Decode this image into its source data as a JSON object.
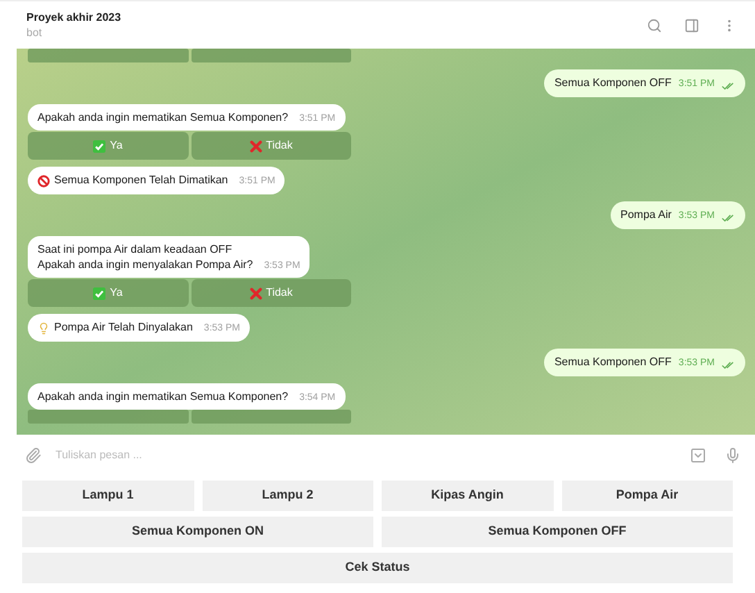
{
  "header": {
    "title": "Proyek akhir 2023",
    "subtitle": "bot"
  },
  "messages": [
    {
      "kind": "buttons-cut",
      "buttons": [
        {
          "kind": "yes"
        },
        {
          "kind": "no"
        }
      ]
    },
    {
      "kind": "outgoing",
      "text": "Semua Komponen OFF",
      "time": "3:51 PM",
      "read": true
    },
    {
      "kind": "incoming",
      "lines": [
        "Apakah anda ingin mematikan Semua Komponen?"
      ],
      "time": "3:51 PM"
    },
    {
      "kind": "buttons",
      "buttons": [
        {
          "kind": "yes",
          "label": "Ya"
        },
        {
          "kind": "no",
          "label": "Tidak"
        }
      ]
    },
    {
      "kind": "notice",
      "on": false,
      "text": "Semua Komponen Telah Dimatikan",
      "time": "3:51 PM"
    },
    {
      "kind": "outgoing",
      "text": "Pompa Air",
      "time": "3:53 PM",
      "read": true
    },
    {
      "kind": "incoming",
      "lines": [
        "Saat ini pompa Air dalam keadaan OFF",
        "Apakah anda ingin menyalakan Pompa Air?"
      ],
      "time": "3:53 PM"
    },
    {
      "kind": "buttons",
      "buttons": [
        {
          "kind": "yes",
          "label": "Ya"
        },
        {
          "kind": "no",
          "label": "Tidak"
        }
      ]
    },
    {
      "kind": "notice",
      "on": true,
      "text": "Pompa Air Telah Dinyalakan",
      "time": "3:53 PM"
    },
    {
      "kind": "outgoing",
      "text": "Semua Komponen OFF",
      "time": "3:53 PM",
      "read": true
    },
    {
      "kind": "incoming",
      "lines": [
        "Apakah anda ingin mematikan Semua Komponen?"
      ],
      "time": "3:54 PM"
    },
    {
      "kind": "buttons-cut",
      "buttons": [
        {
          "kind": "yes"
        },
        {
          "kind": "no"
        }
      ]
    }
  ],
  "composer": {
    "placeholder": "Tuliskan pesan ..."
  },
  "keyboard": [
    [
      "Lampu 1",
      "Lampu 2",
      "Kipas Angin",
      "Pompa Air"
    ],
    [
      "Semua Komponen ON",
      "Semua Komponen OFF"
    ],
    [
      "Cek Status"
    ]
  ]
}
